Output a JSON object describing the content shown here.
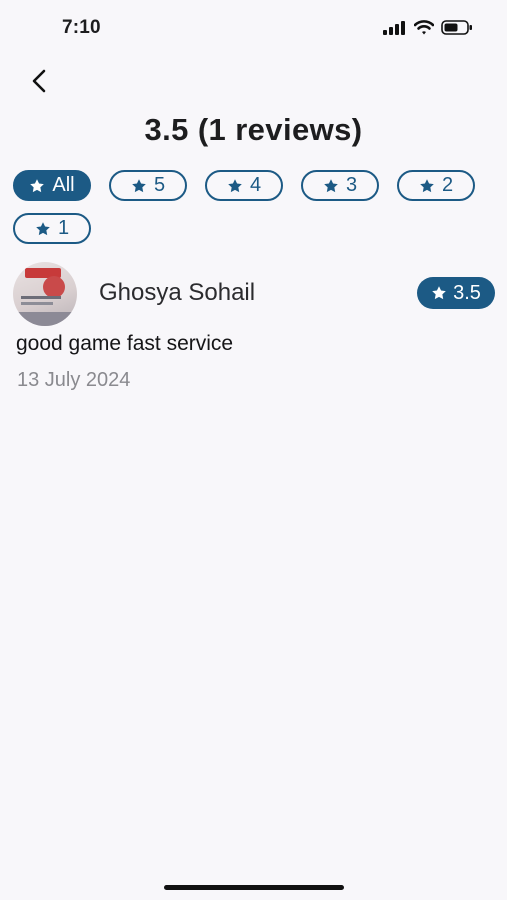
{
  "status_bar": {
    "time": "7:10"
  },
  "header": {
    "title": "3.5 (1 reviews)"
  },
  "filters": [
    {
      "label": "All",
      "icon": "star-icon",
      "selected": true
    },
    {
      "label": "5",
      "icon": "star-icon",
      "selected": false
    },
    {
      "label": "4",
      "icon": "star-icon",
      "selected": false
    },
    {
      "label": "3",
      "icon": "star-icon",
      "selected": false
    },
    {
      "label": "2",
      "icon": "star-icon",
      "selected": false
    },
    {
      "label": "1",
      "icon": "star-icon",
      "selected": false
    }
  ],
  "reviews": [
    {
      "name": "Ghosya Sohail",
      "rating": "3.5",
      "text": "good game fast service",
      "date": "13 July 2024"
    }
  ],
  "colors": {
    "accent": "#1c5a85",
    "background": "#f8f7fa",
    "date_text": "#8a8a8f"
  }
}
